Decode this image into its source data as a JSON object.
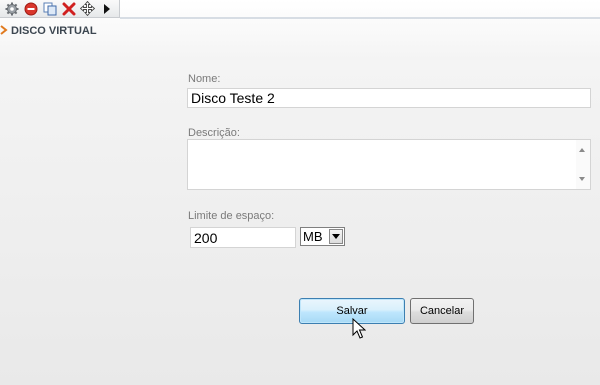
{
  "toolbar": {
    "icons": [
      "gear-icon",
      "remove-icon",
      "copy-icon",
      "delete-icon",
      "move-icon",
      "play-arrow-icon"
    ]
  },
  "section": {
    "title": "DISCO VIRTUAL",
    "icon": "chevron-right-icon",
    "accent_color": "#e07a1f"
  },
  "form": {
    "name_label": "Nome:",
    "name_value": "Disco Teste 2",
    "description_label": "Descrição:",
    "description_value": "",
    "limit_label": "Limite de espaço:",
    "limit_value": "200",
    "unit_selected": "MB"
  },
  "buttons": {
    "save_label": "Salvar",
    "cancel_label": "Cancelar"
  }
}
